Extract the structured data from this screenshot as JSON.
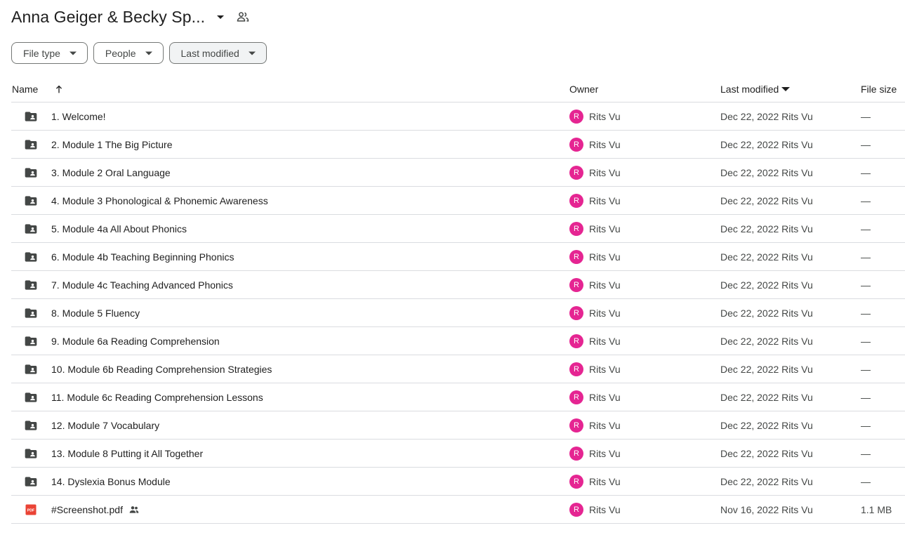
{
  "header": {
    "title": "Anna Geiger & Becky Sp...",
    "title_caret_icon": "arrow-drop-down-icon",
    "shared_icon": "people-icon"
  },
  "filters": [
    {
      "label": "File type",
      "active": false
    },
    {
      "label": "People",
      "active": false
    },
    {
      "label": "Last modified",
      "active": true
    }
  ],
  "columns": {
    "name": "Name",
    "owner": "Owner",
    "last_modified": "Last modified",
    "file_size": "File size"
  },
  "colors": {
    "avatar": "#e52592",
    "folder_icon": "#444746",
    "pdf_icon": "#ea4335",
    "divider": "#dadce0"
  },
  "rows": [
    {
      "name": "1. Welcome!",
      "type": "shared-folder",
      "owner_initial": "R",
      "owner": "Rits Vu",
      "modified": "Dec 22, 2022 Rits Vu",
      "size": "—"
    },
    {
      "name": "2. Module 1 The Big Picture",
      "type": "shared-folder",
      "owner_initial": "R",
      "owner": "Rits Vu",
      "modified": "Dec 22, 2022 Rits Vu",
      "size": "—"
    },
    {
      "name": "3. Module 2 Oral Language",
      "type": "shared-folder",
      "owner_initial": "R",
      "owner": "Rits Vu",
      "modified": "Dec 22, 2022 Rits Vu",
      "size": "—"
    },
    {
      "name": "4. Module 3 Phonological & Phonemic Awareness",
      "type": "shared-folder",
      "owner_initial": "R",
      "owner": "Rits Vu",
      "modified": "Dec 22, 2022 Rits Vu",
      "size": "—"
    },
    {
      "name": "5. Module 4a All About Phonics",
      "type": "shared-folder",
      "owner_initial": "R",
      "owner": "Rits Vu",
      "modified": "Dec 22, 2022 Rits Vu",
      "size": "—"
    },
    {
      "name": "6. Module 4b Teaching Beginning Phonics",
      "type": "shared-folder",
      "owner_initial": "R",
      "owner": "Rits Vu",
      "modified": "Dec 22, 2022 Rits Vu",
      "size": "—"
    },
    {
      "name": "7. Module 4c Teaching Advanced Phonics",
      "type": "shared-folder",
      "owner_initial": "R",
      "owner": "Rits Vu",
      "modified": "Dec 22, 2022 Rits Vu",
      "size": "—"
    },
    {
      "name": "8. Module 5 Fluency",
      "type": "shared-folder",
      "owner_initial": "R",
      "owner": "Rits Vu",
      "modified": "Dec 22, 2022 Rits Vu",
      "size": "—"
    },
    {
      "name": "9. Module 6a Reading Comprehension",
      "type": "shared-folder",
      "owner_initial": "R",
      "owner": "Rits Vu",
      "modified": "Dec 22, 2022 Rits Vu",
      "size": "—"
    },
    {
      "name": "10. Module 6b Reading Comprehension Strategies",
      "type": "shared-folder",
      "owner_initial": "R",
      "owner": "Rits Vu",
      "modified": "Dec 22, 2022 Rits Vu",
      "size": "—"
    },
    {
      "name": "11. Module 6c Reading Comprehension Lessons",
      "type": "shared-folder",
      "owner_initial": "R",
      "owner": "Rits Vu",
      "modified": "Dec 22, 2022 Rits Vu",
      "size": "—"
    },
    {
      "name": "12. Module 7 Vocabulary",
      "type": "shared-folder",
      "owner_initial": "R",
      "owner": "Rits Vu",
      "modified": "Dec 22, 2022 Rits Vu",
      "size": "—"
    },
    {
      "name": "13. Module 8 Putting it All Together",
      "type": "shared-folder",
      "owner_initial": "R",
      "owner": "Rits Vu",
      "modified": "Dec 22, 2022 Rits Vu",
      "size": "—"
    },
    {
      "name": "14. Dyslexia Bonus Module",
      "type": "shared-folder",
      "owner_initial": "R",
      "owner": "Rits Vu",
      "modified": "Dec 22, 2022 Rits Vu",
      "size": "—"
    },
    {
      "name": "#Screenshot.pdf",
      "type": "pdf",
      "shared": true,
      "owner_initial": "R",
      "owner": "Rits Vu",
      "modified": "Nov 16, 2022 Rits Vu",
      "size": "1.1 MB"
    }
  ]
}
